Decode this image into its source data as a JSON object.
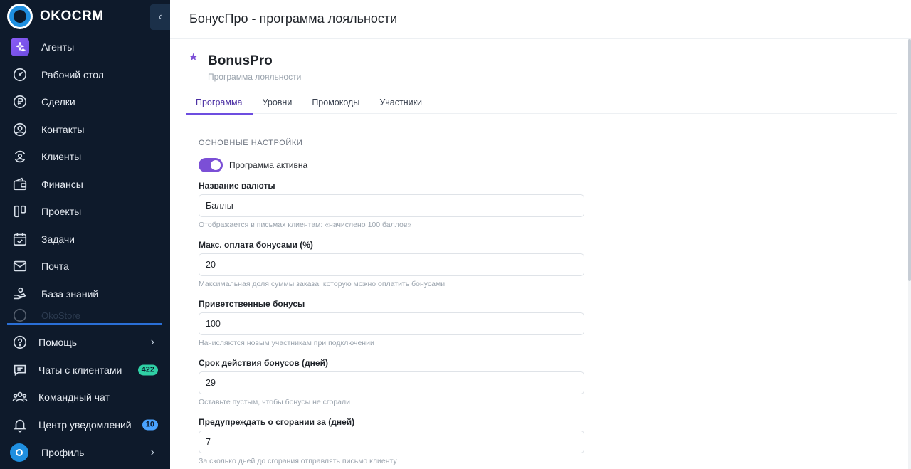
{
  "brand": {
    "name": "OKOCRM"
  },
  "sidebar": {
    "collapse_icon": "chevron-left-icon",
    "items": [
      {
        "label": "Агенты",
        "icon": "sparkle-icon"
      },
      {
        "label": "Рабочий стол",
        "icon": "gauge-icon"
      },
      {
        "label": "Сделки",
        "icon": "ruble-icon"
      },
      {
        "label": "Контакты",
        "icon": "user-circle-icon"
      },
      {
        "label": "Клиенты",
        "icon": "client-icon"
      },
      {
        "label": "Финансы",
        "icon": "wallet-icon"
      },
      {
        "label": "Проекты",
        "icon": "kanban-icon"
      },
      {
        "label": "Задачи",
        "icon": "calendar-check-icon"
      },
      {
        "label": "Почта",
        "icon": "mail-icon"
      },
      {
        "label": "База знаний",
        "icon": "knowledge-icon"
      }
    ],
    "faded_item": "OkoStore",
    "bottom": [
      {
        "label": "Помощь",
        "icon": "help-icon"
      },
      {
        "label": "Чаты с клиентами",
        "icon": "chat-icon",
        "badge": "422"
      },
      {
        "label": "Командный чат",
        "icon": "team-icon"
      },
      {
        "label": "Центр уведомлений",
        "icon": "bell-icon",
        "badge": "10"
      },
      {
        "label": "Профиль",
        "icon": "profile-icon"
      }
    ]
  },
  "header": {
    "title": "БонусПро - программа лояльности"
  },
  "module": {
    "name": "BonusPro",
    "subtitle": "Программа лояльности"
  },
  "tabs": [
    {
      "label": "Программа",
      "active": true
    },
    {
      "label": "Уровни"
    },
    {
      "label": "Промокоды"
    },
    {
      "label": "Участники"
    }
  ],
  "settings": {
    "section_title": "ОСНОВНЫЕ НАСТРОЙКИ",
    "toggle": {
      "label": "Программа активна",
      "on": true
    },
    "fields": [
      {
        "label": "Название валюты",
        "value": "Баллы",
        "hint": "Отображается в письмах клиентам: «начислено 100 баллов»"
      },
      {
        "label": "Макс. оплата бонусами (%)",
        "value": "20",
        "hint": "Максимальная доля суммы заказа, которую можно оплатить бонусами"
      },
      {
        "label": "Приветственные бонусы",
        "value": "100",
        "hint": "Начисляются новым участникам при подключении"
      },
      {
        "label": "Срок действия бонусов (дней)",
        "value": "29",
        "hint": "Оставьте пустым, чтобы бонусы не сгорали"
      },
      {
        "label": "Предупреждать о сгорании за (дней)",
        "value": "7",
        "hint": "За сколько дней до сгорания отправлять письмо клиенту"
      }
    ]
  },
  "colors": {
    "sidebar_bg": "#0e1a2b",
    "accent": "#7b4fd6",
    "brand_blue": "#1f8fe0"
  }
}
